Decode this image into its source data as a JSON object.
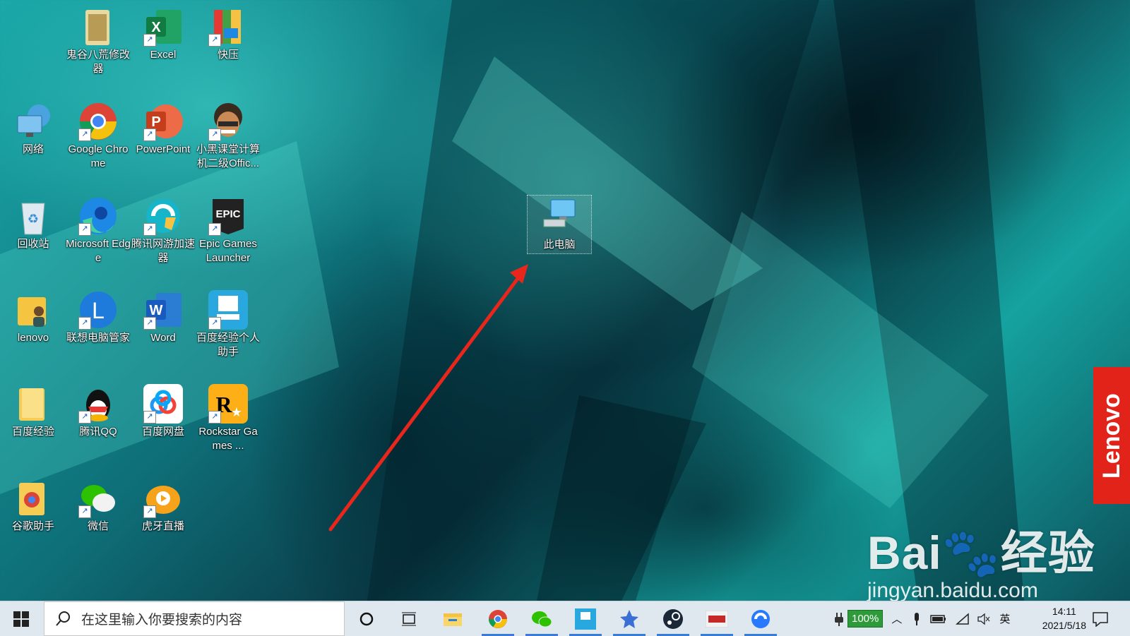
{
  "desktop": {
    "icons": [
      {
        "label": "鬼谷八荒修改器",
        "icon": "game-trainer-icon"
      },
      {
        "label": "Excel",
        "icon": "excel-icon"
      },
      {
        "label": "快压",
        "icon": "kuaiya-icon"
      },
      {
        "label": "网络",
        "icon": "network-icon"
      },
      {
        "label": "Google Chrome",
        "icon": "chrome-icon"
      },
      {
        "label": "PowerPoint",
        "icon": "powerpoint-icon"
      },
      {
        "label": "小黑课堂计算机二级Offic...",
        "icon": "xiaohei-icon"
      },
      {
        "label": "回收站",
        "icon": "recycle-bin-icon"
      },
      {
        "label": "Microsoft Edge",
        "icon": "edge-icon"
      },
      {
        "label": "腾讯网游加速器",
        "icon": "tencent-accelerator-icon"
      },
      {
        "label": "Epic Games Launcher",
        "icon": "epic-games-icon"
      },
      {
        "label": "lenovo",
        "icon": "user-folder-icon"
      },
      {
        "label": "联想电脑管家",
        "icon": "lenovo-manager-icon"
      },
      {
        "label": "Word",
        "icon": "word-icon"
      },
      {
        "label": "百度经验个人助手",
        "icon": "baidu-experience-assistant-icon"
      },
      {
        "label": "百度经验",
        "icon": "folder-icon"
      },
      {
        "label": "腾讯QQ",
        "icon": "qq-icon"
      },
      {
        "label": "百度网盘",
        "icon": "baidu-netdisk-icon"
      },
      {
        "label": "Rockstar Games ...",
        "icon": "rockstar-icon"
      },
      {
        "label": "谷歌助手",
        "icon": "google-assistant-icon"
      },
      {
        "label": "微信",
        "icon": "wechat-icon"
      },
      {
        "label": "虎牙直播",
        "icon": "huya-icon"
      }
    ],
    "this_pc": {
      "label": "此电脑",
      "icon": "computer-icon"
    },
    "lenovo_brand": "Lenovo",
    "watermark": {
      "brand": "Bai",
      "brand2": "经验",
      "url": "jingyan.baidu.com"
    }
  },
  "taskbar": {
    "search_placeholder": "在这里输入你要搜索的内容",
    "battery": "100%",
    "ime": "英",
    "time": "14:11",
    "date": "2021/5/18"
  },
  "colors": {
    "accent": "#3a7bd5",
    "lenovo_red": "#e2231a",
    "arrow": "#e8261c"
  }
}
